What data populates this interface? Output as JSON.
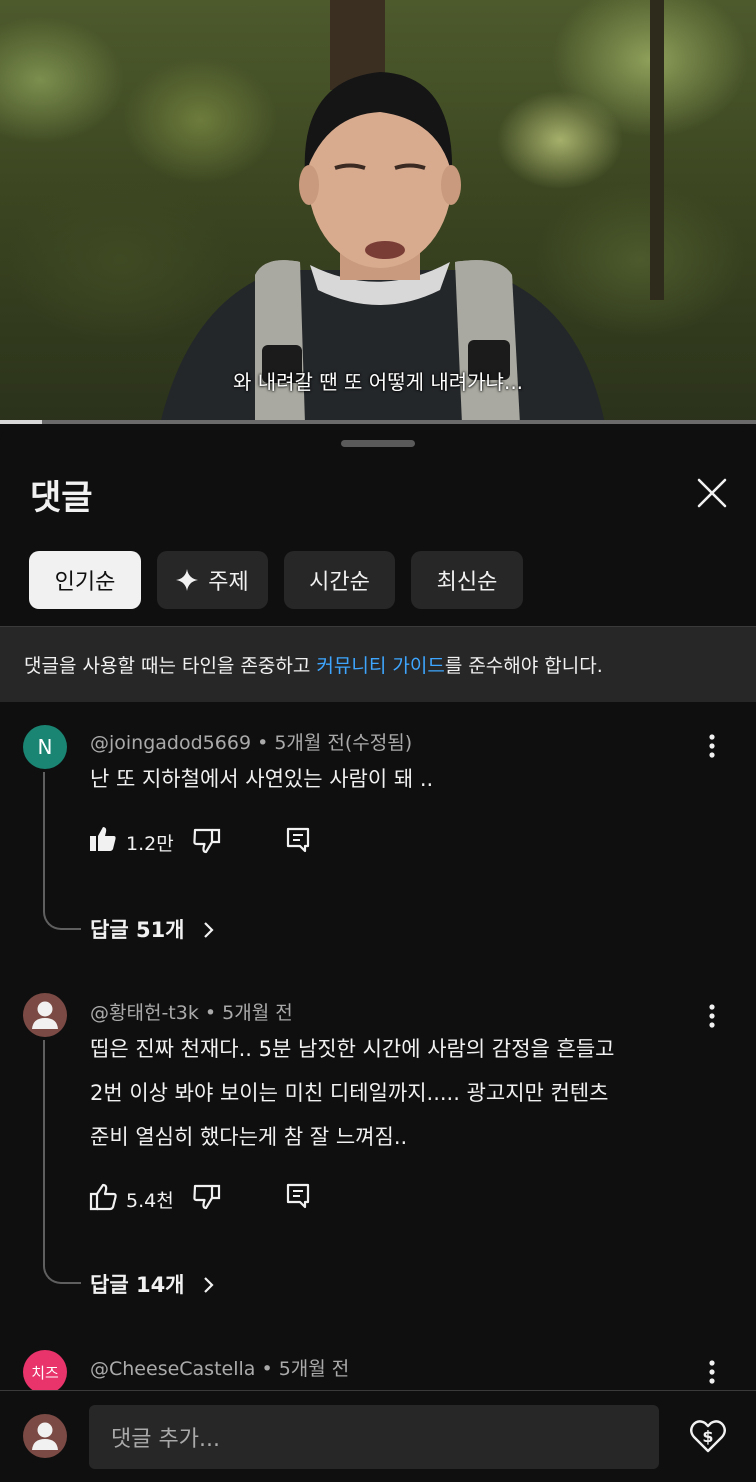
{
  "video": {
    "subtitle": "와 내려갈 땐 또 어떻게 내려가냐...",
    "progress": 0.055
  },
  "comments_panel": {
    "title": "댓글",
    "sort_chips": [
      {
        "label": "인기순",
        "active": true
      },
      {
        "label": "주제",
        "icon": "sparkle-icon",
        "active": false
      },
      {
        "label": "시간순",
        "active": false
      },
      {
        "label": "최신순",
        "active": false
      }
    ],
    "notice": {
      "before": "댓글을 사용할 때는 타인을 존중하고 ",
      "link": "커뮤니티 가이드",
      "after": "를 준수해야 합니다."
    },
    "comments": [
      {
        "avatar_letter": "N",
        "avatar_color": "#1a8573",
        "meta": "@joingadod5669 • 5개월 전(수정됨)",
        "lines": [
          "난 또 지하철에서 사연있는 사람이 돼 .."
        ],
        "likes": "1.2만",
        "liked": true,
        "replies": "답글 51개"
      },
      {
        "avatar_icon": "default-user-icon",
        "meta": "@황태헌-t3k • 5개월 전",
        "lines": [
          "띱은 진짜 천재다.. 5분 남짓한 시간에 사람의 감정을 흔들고",
          "2번 이상 봐야 보이는 미친 디테일까지..... 광고지만 컨텐츠",
          "준비 열심히 했다는게 참 잘 느껴짐.."
        ],
        "likes": "5.4천",
        "liked": false,
        "replies": "답글 14개"
      },
      {
        "avatar_letter": "치즈",
        "avatar_color": "#e8336b",
        "meta": "@CheeseCastella • 5개월 전"
      }
    ],
    "input_placeholder": "댓글 추가...",
    "colors": {
      "background": "#0f0f0f",
      "chip": "#272727",
      "link": "#3ea6ff",
      "meta": "#aaaaaa"
    }
  }
}
